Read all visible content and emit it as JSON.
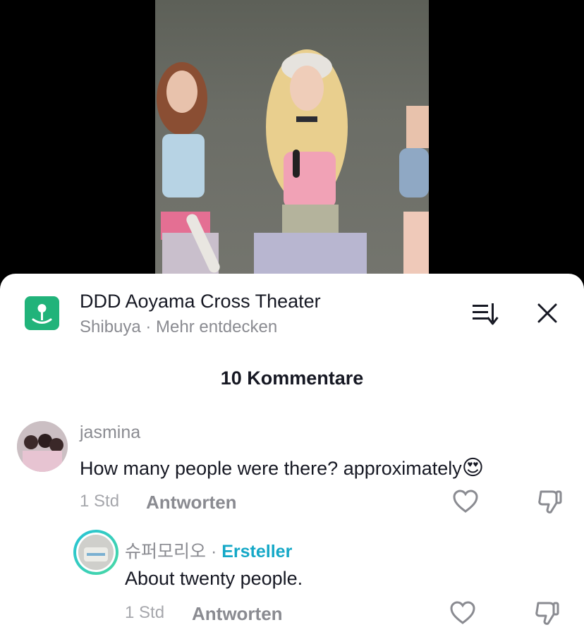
{
  "location": {
    "title": "DDD Aoyama Cross Theater",
    "subtitle": "Shibuya · Mehr entdecken"
  },
  "comments_count": "10 Kommentare",
  "comments": [
    {
      "username": "jasmina",
      "text": "How many people were there? approximately",
      "emoji": "😍",
      "time": "1 Std",
      "reply_label": "Antworten"
    }
  ],
  "replies": [
    {
      "username": "슈퍼모리오",
      "separator": "·",
      "badge": "Ersteller",
      "text": "About twenty people.",
      "time": "1 Std",
      "reply_label": "Antworten"
    }
  ],
  "icons": {
    "location": "location-pin-icon",
    "sort": "sort-icon",
    "close": "close-icon",
    "like": "heart-icon",
    "dislike": "thumbs-down-icon"
  },
  "colors": {
    "location_green": "#21b37a",
    "creator_badge": "#15a8c7",
    "avatar_ring": "#25c2d7"
  }
}
